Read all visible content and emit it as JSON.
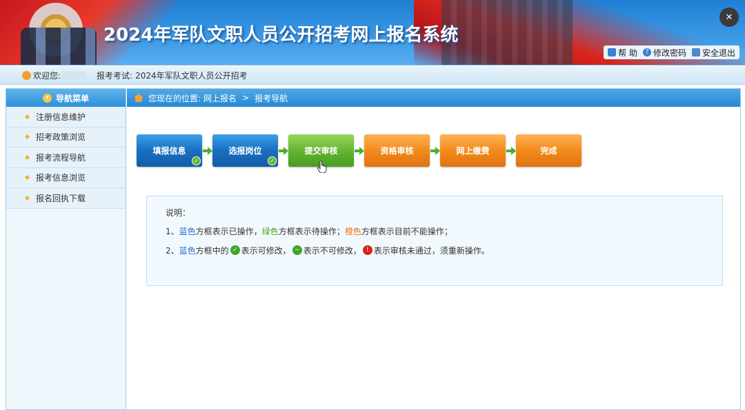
{
  "header": {
    "title": "2024年军队文职人员公开招考网上报名系统",
    "links": {
      "help": "帮 助",
      "change_password": "修改密码",
      "logout": "安全退出"
    }
  },
  "welcome": {
    "greeting": "欢迎您:",
    "exam_label": "报考考试:",
    "exam_name": "2024年军队文职人员公开招考"
  },
  "sidebar": {
    "title": "导航菜单",
    "items": [
      {
        "label": "注册信息维护"
      },
      {
        "label": "招考政策浏览"
      },
      {
        "label": "报考流程导航"
      },
      {
        "label": "报考信息浏览"
      },
      {
        "label": "报名回执下载"
      }
    ]
  },
  "breadcrumb": {
    "prefix": "您现在的位置:",
    "level1": "网上报名",
    "separator": ">",
    "level2": "报考导航"
  },
  "steps": [
    {
      "label": "填报信息",
      "state": "blue",
      "checked": true
    },
    {
      "label": "选报岗位",
      "state": "blue",
      "checked": true
    },
    {
      "label": "提交审核",
      "state": "green",
      "checked": false
    },
    {
      "label": "资格审核",
      "state": "orange",
      "checked": false
    },
    {
      "label": "网上缴费",
      "state": "orange",
      "checked": false
    },
    {
      "label": "完成",
      "state": "orange",
      "checked": false
    }
  ],
  "description": {
    "heading": "说明：",
    "line1": {
      "num": "1、",
      "blue": "蓝色",
      "t1": "方框表示已操作，",
      "green": "绿色",
      "t2": "方框表示待操作；",
      "orange": "橙色",
      "t3": "方框表示目前不能操作；"
    },
    "line2": {
      "num": "2、",
      "blue": "蓝色",
      "t1": "方框中的",
      "t2": "表示可修改，",
      "t3": "表示不可修改，",
      "t4": "表示审核未通过，须重新操作。"
    }
  },
  "colors": {
    "step_done": "#1a6fc1",
    "step_pending": "#5fb330",
    "step_locked": "#f28b1b",
    "nav_blue": "#2f8fd7"
  }
}
